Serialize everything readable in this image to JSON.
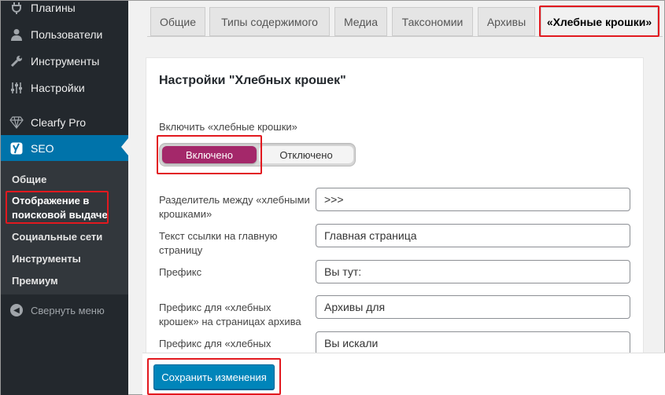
{
  "sidebar": {
    "items": [
      {
        "label": "Плагины",
        "icon": "plugin-icon"
      },
      {
        "label": "Пользователи",
        "icon": "users-icon"
      },
      {
        "label": "Инструменты",
        "icon": "tools-icon"
      },
      {
        "label": "Настройки",
        "icon": "settings-icon"
      },
      {
        "label": "Clearfy Pro",
        "icon": "diamond-icon"
      },
      {
        "label": "SEO",
        "icon": "yoast-icon"
      }
    ],
    "submenu": [
      {
        "label": "Общие"
      },
      {
        "label": "Отображение в поисковой выдаче"
      },
      {
        "label": "Социальные сети"
      },
      {
        "label": "Инструменты"
      },
      {
        "label": "Премиум"
      }
    ],
    "collapse_label": "Свернуть меню"
  },
  "tabs": [
    {
      "label": "Общие"
    },
    {
      "label": "Типы содержимого"
    },
    {
      "label": "Медиа"
    },
    {
      "label": "Таксономии"
    },
    {
      "label": "Архивы"
    },
    {
      "label": "«Хлебные крошки»"
    }
  ],
  "panel": {
    "title": "Настройки \"Хлебных крошек\"",
    "toggle_label": "Включить «хлебные крошки»",
    "toggle_on": "Включено",
    "toggle_off": "Отключено",
    "fields": [
      {
        "label": "Разделитель между «хлебными крошками»",
        "value": ">>>"
      },
      {
        "label": "Текст ссылки на главную страницу",
        "value": "Главная страница"
      },
      {
        "label": "Префикс",
        "value": "Вы тут:"
      },
      {
        "label": "Префикс для «хлебных крошек» на страницах архива",
        "value": "Архивы для"
      },
      {
        "label": "Префикс для «хлебных крошек»",
        "value": "Вы искали"
      }
    ]
  },
  "footer": {
    "save_label": "Сохранить изменения"
  },
  "colors": {
    "accent": "#0085ba",
    "toggle_on": "#a4286a",
    "highlight": "#e2191f",
    "sidebar_bg": "#23282d",
    "active_menu": "#0073aa"
  }
}
